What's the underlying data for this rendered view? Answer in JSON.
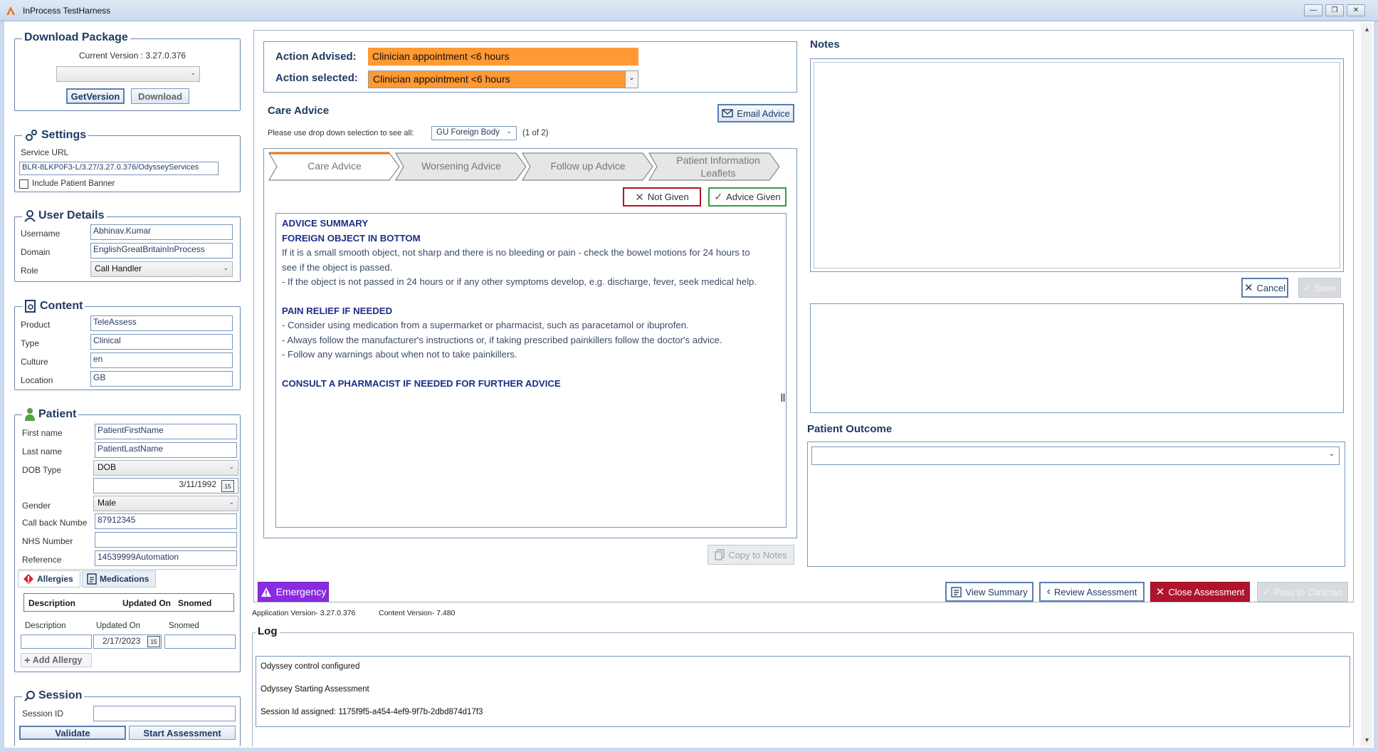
{
  "window": {
    "title": "InProcess TestHarness"
  },
  "download_package": {
    "legend": "Download Package",
    "current_version": "Current Version :  3.27.0.376",
    "version_select": "",
    "getversion_label": "GetVersion",
    "download_label": "Download"
  },
  "settings": {
    "legend": "Settings",
    "service_url_label": "Service URL",
    "service_url": "BLR-8LKP0F3-L/3.27/3.27.0.376/OdysseyServices",
    "include_banner_label": "Include Patient Banner"
  },
  "user_details": {
    "legend": "User Details",
    "username_label": "Username",
    "username": "Abhinav.Kumar",
    "domain_label": "Domain",
    "domain": "EnglishGreatBritainInProcess",
    "role_label": "Role",
    "role": "Call Handler"
  },
  "content": {
    "legend": "Content",
    "product_label": "Product",
    "product": "TeleAssess",
    "type_label": "Type",
    "type": "Clinical",
    "culture_label": "Culture",
    "culture": "en",
    "location_label": "Location",
    "location": "GB"
  },
  "patient": {
    "legend": "Patient",
    "first_name_label": "First name",
    "first_name": "PatientFirstName",
    "last_name_label": "Last name",
    "last_name": "PatientLastName",
    "dob_type_label": "DOB Type",
    "dob_type": "DOB",
    "dob": "3/11/1992",
    "gender_label": "Gender",
    "gender": "Male",
    "callback_label": "Call back Numbe",
    "callback": "87912345",
    "nhs_label": "NHS Number",
    "nhs": "",
    "reference_label": "Reference",
    "reference": "14539999Automation",
    "tab_allergies": "Allergies",
    "tab_medications": "Medications",
    "grid_headers": [
      "Description",
      "Updated On",
      "Snomed"
    ],
    "new_description_label": "Description",
    "new_updated_label": "Updated On",
    "new_snomed_label": "Snomed",
    "new_updated_value": "2/17/2023",
    "add_allergy_label": "Add Allergy"
  },
  "session": {
    "legend": "Session",
    "session_id_label": "Session ID",
    "session_id": "",
    "validate_label": "Validate",
    "start_label": "Start Assessment"
  },
  "action": {
    "advised_label": "Action Advised:",
    "advised_value": "Clinician appointment <6 hours",
    "selected_label": "Action selected:",
    "selected_value": "Clinician appointment <6 hours"
  },
  "care_advice": {
    "title": "Care Advice",
    "email_label": "Email Advice",
    "dropdown_hint": "Please use drop down selection to see all:",
    "dropdown_value": "GU Foreign Body",
    "page_count": "(1 of 2)",
    "tabs": [
      "Care Advice",
      "Worsening Advice",
      "Follow up Advice",
      "Patient Information Leaflets"
    ],
    "not_given_label": "Not Given",
    "advice_given_label": "Advice Given",
    "summary_heading": "ADVICE SUMMARY",
    "section1_heading": "FOREIGN OBJECT IN BOTTOM",
    "section1_line1": "If it is a small smooth object, not sharp and there is no bleeding or pain - check the bowel motions for 24 hours to see if the object is passed.",
    "section1_line2": "- If the object is not passed in 24 hours or if any other symptoms develop, e.g. discharge, fever, seek medical help.",
    "section2_heading": "PAIN RELIEF IF NEEDED",
    "section2_line1": "- Consider using medication from a supermarket or pharmacist, such as paracetamol or ibuprofen.",
    "section2_line2": "- Always follow the manufacturer's instructions or, if taking prescribed painkillers follow the doctor's advice.",
    "section2_line3": "- Follow any warnings about when not to take painkillers.",
    "section3_heading": "CONSULT A PHARMACIST IF NEEDED FOR FURTHER ADVICE",
    "copy_label": "Copy to Notes"
  },
  "notes": {
    "title": "Notes",
    "cancel_label": "Cancel",
    "save_label": "Save",
    "outcome_title": "Patient Outcome",
    "outcome_value": ""
  },
  "bottom_bar": {
    "emergency_label": "Emergency",
    "view_summary_label": "View Summary",
    "review_label": "Review Assessment",
    "close_label": "Close Assessment",
    "pass_label": "Pass to Clinician",
    "app_version": "Application Version- 3.27.0.376",
    "content_version": "Content Version- 7.480"
  },
  "log": {
    "legend": "Log",
    "lines": [
      "Odyssey control configured",
      "Odyssey Starting Assessment",
      "Session Id assigned: 1175f9f5-a454-4ef9-9f7b-2dbd874d17f3"
    ]
  },
  "colors": {
    "accent_orange": "#ff9933",
    "emergency_purple": "#8a2be2",
    "close_red": "#b0142c",
    "heading_blue": "#1f3b63"
  }
}
